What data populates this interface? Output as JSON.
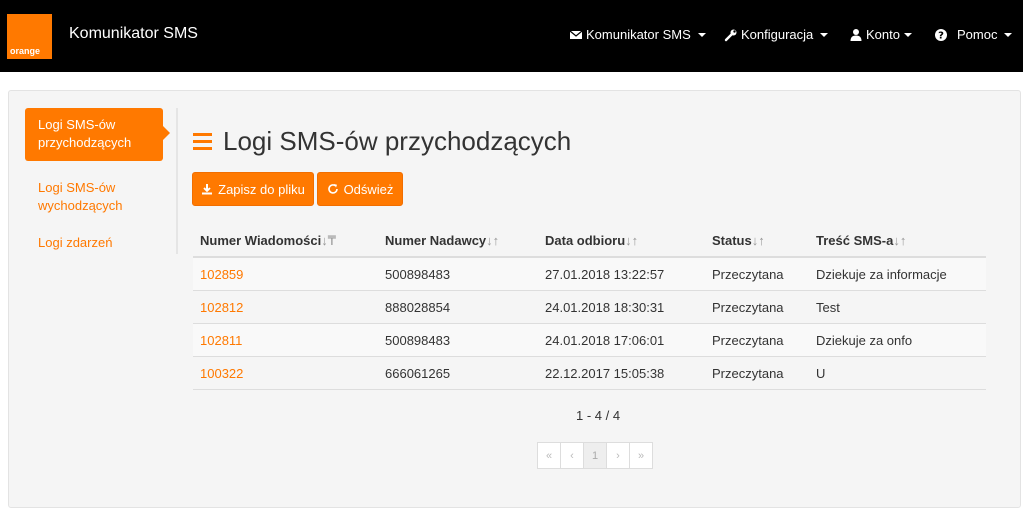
{
  "navbar": {
    "logo_text": "orange",
    "app_title": "Komunikator SMS",
    "items": [
      {
        "label": "Komunikator SMS",
        "icon": "envelope-icon"
      },
      {
        "label": "Konfiguracja",
        "icon": "wrench-icon"
      },
      {
        "label": "Konto",
        "icon": "user-icon"
      },
      {
        "label": "Pomoc",
        "icon": "question-circle-icon"
      }
    ]
  },
  "sidebar": {
    "items": [
      {
        "label_line1": "Logi SMS-ów",
        "label_line2": "przychodzących",
        "active": true
      },
      {
        "label_line1": "Logi SMS-ów",
        "label_line2": "wychodzących",
        "active": false
      },
      {
        "label_line1": "Logi zdarzeń",
        "label_line2": "",
        "active": false
      }
    ]
  },
  "main": {
    "title": "Logi SMS-ów przychodzących",
    "buttons": {
      "save": "Zapisz do pliku",
      "refresh": "Odśwież"
    },
    "table": {
      "headers": [
        "Numer Wiadomości",
        "Numer Nadawcy",
        "Data odbioru",
        "Status",
        "Treść SMS-a"
      ],
      "rows": [
        [
          "102859",
          "500898483",
          "27.01.2018 13:22:57",
          "Przeczytana",
          "Dziekuje za informacje"
        ],
        [
          "102812",
          "888028854",
          "24.01.2018 18:30:31",
          "Przeczytana",
          "Test"
        ],
        [
          "102811",
          "500898483",
          "24.01.2018 17:06:01",
          "Przeczytana",
          "Dziekuje za onfo"
        ],
        [
          "100322",
          "666061265",
          "22.12.2017 15:05:38",
          "Przeczytana",
          "U"
        ]
      ]
    },
    "pager_info": "1 - 4 / 4",
    "pagination": [
      "«",
      "‹",
      "1",
      "›",
      "»"
    ]
  },
  "colors": {
    "brand": "#ff7900",
    "navbar": "#000000"
  }
}
